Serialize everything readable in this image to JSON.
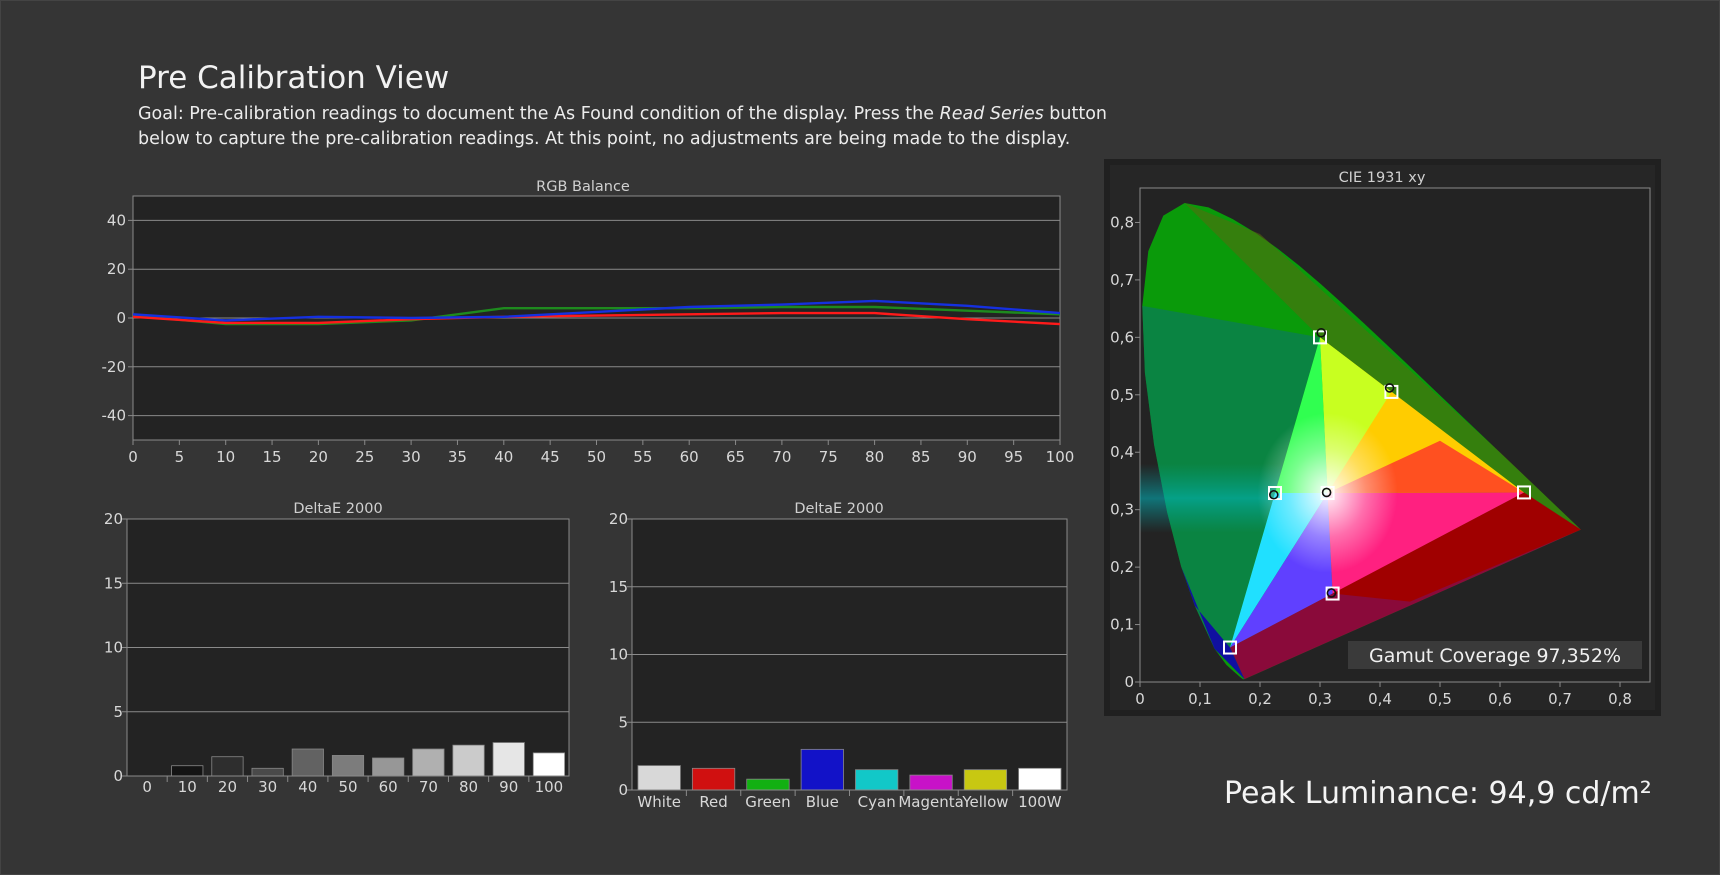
{
  "page": {
    "title": "Pre Calibration View",
    "goal_prefix": "Goal: Pre-calibration readings to document the As Found condition of the display. Press the ",
    "goal_emphasis": "Read Series",
    "goal_suffix": " button below to capture the pre-calibration readings. At this point, no adjustments are being made to the display."
  },
  "colors": {
    "background": "#353535",
    "plot_background": "#232323",
    "red_series": "#ff1a1a",
    "green_series": "#1e8a1e",
    "blue_series": "#1530e0"
  },
  "peak_luminance": "Peak Luminance: 94,9 cd/m²",
  "chart_data": [
    {
      "id": "rgb_balance",
      "type": "line",
      "title": "RGB Balance",
      "xlabel": "",
      "ylabel": "",
      "x": [
        0,
        10,
        20,
        30,
        40,
        50,
        60,
        70,
        80,
        90,
        100
      ],
      "xticks": [
        "0",
        "5",
        "10",
        "15",
        "20",
        "25",
        "30",
        "35",
        "40",
        "45",
        "50",
        "55",
        "60",
        "65",
        "70",
        "75",
        "80",
        "85",
        "90",
        "95",
        "100"
      ],
      "yticks": [
        "40",
        "20",
        "0",
        "-20",
        "-40"
      ],
      "xlim": [
        0,
        100
      ],
      "ylim": [
        -50,
        50
      ],
      "grid": true,
      "series": [
        {
          "color": "#1e8a1e",
          "values": [
            1,
            -2.5,
            -2.5,
            -1,
            4,
            4,
            4,
            4.5,
            4.5,
            3,
            1.5
          ]
        },
        {
          "color": "#ff1a1a",
          "values": [
            0.5,
            -2,
            -2,
            -0.5,
            0.5,
            1,
            1.5,
            2,
            2,
            -0.5,
            -2.5
          ]
        },
        {
          "color": "#1530e0",
          "values": [
            1.5,
            -1,
            0.5,
            0,
            0.5,
            2.5,
            4.5,
            5.5,
            7,
            5,
            2
          ]
        }
      ]
    },
    {
      "id": "deltae_grayscale",
      "type": "bar",
      "title": "DeltaE 2000",
      "categories": [
        "0",
        "10",
        "20",
        "30",
        "40",
        "50",
        "60",
        "70",
        "80",
        "90",
        "100"
      ],
      "values": [
        0,
        0.8,
        1.5,
        0.6,
        2.1,
        1.6,
        1.4,
        2.1,
        2.4,
        2.6,
        1.8
      ],
      "bar_colors": [
        "#0a0a0a",
        "#141414",
        "#2e2e2e",
        "#4a4a4a",
        "#626262",
        "#7c7c7c",
        "#979797",
        "#b0b0b0",
        "#cbcbcb",
        "#e6e6e6",
        "#ffffff"
      ],
      "yticks": [
        "20",
        "15",
        "10",
        "5",
        "0"
      ],
      "ylim": [
        0,
        20
      ],
      "grid": true
    },
    {
      "id": "deltae_colors",
      "type": "bar",
      "title": "DeltaE 2000",
      "categories": [
        "White",
        "Red",
        "Green",
        "Blue",
        "Cyan",
        "Magenta",
        "Yellow",
        "100W"
      ],
      "values": [
        1.8,
        1.6,
        0.8,
        3.0,
        1.5,
        1.1,
        1.5,
        1.6
      ],
      "bar_colors": [
        "#d8d8d8",
        "#d01010",
        "#12b012",
        "#1212c8",
        "#12c8c8",
        "#c812c8",
        "#c8c812",
        "#ffffff"
      ],
      "yticks": [
        "20",
        "15",
        "10",
        "5",
        "0"
      ],
      "ylim": [
        0,
        20
      ],
      "grid": true
    },
    {
      "id": "cie_1931",
      "type": "scatter",
      "title": "CIE 1931 xy",
      "xticks": [
        "0",
        "0,1",
        "0,2",
        "0,3",
        "0,4",
        "0,5",
        "0,6",
        "0,7",
        "0,8"
      ],
      "yticks": [
        "0,8",
        "0,7",
        "0,6",
        "0,5",
        "0,4",
        "0,3",
        "0,2",
        "0,1",
        "0"
      ],
      "xlim": [
        0,
        0.85
      ],
      "ylim": [
        0,
        0.86
      ],
      "targets": [
        {
          "name": "R",
          "x": 0.64,
          "y": 0.33
        },
        {
          "name": "G",
          "x": 0.3,
          "y": 0.6
        },
        {
          "name": "B",
          "x": 0.15,
          "y": 0.06
        },
        {
          "name": "C",
          "x": 0.225,
          "y": 0.329
        },
        {
          "name": "M",
          "x": 0.321,
          "y": 0.154
        },
        {
          "name": "Y",
          "x": 0.419,
          "y": 0.505
        },
        {
          "name": "W",
          "x": 0.3127,
          "y": 0.329
        }
      ],
      "measured": [
        {
          "name": "G",
          "x": 0.302,
          "y": 0.608
        },
        {
          "name": "C",
          "x": 0.223,
          "y": 0.326
        },
        {
          "name": "M",
          "x": 0.319,
          "y": 0.155
        },
        {
          "name": "Y",
          "x": 0.416,
          "y": 0.512
        },
        {
          "name": "W",
          "x": 0.311,
          "y": 0.33
        }
      ],
      "gamut_coverage_label": "Gamut Coverage 97,352%"
    }
  ]
}
